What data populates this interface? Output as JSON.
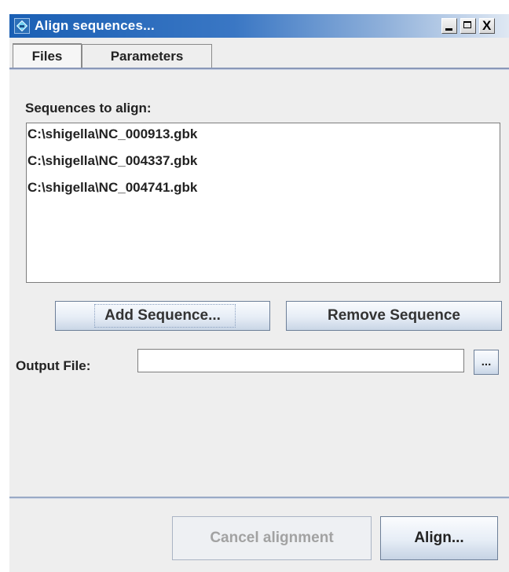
{
  "window": {
    "title": "Align sequences...",
    "minimize_label": "_",
    "maximize_label": "□",
    "close_label": "X"
  },
  "tabs": [
    {
      "label": "Files",
      "active": true
    },
    {
      "label": "Parameters",
      "active": false
    }
  ],
  "files_tab": {
    "sequences_label": "Sequences to align:",
    "sequences": [
      "C:\\shigella\\NC_000913.gbk",
      "C:\\shigella\\NC_004337.gbk",
      "C:\\shigella\\NC_004741.gbk"
    ],
    "add_button": "Add Sequence...",
    "remove_button": "Remove Sequence",
    "output_label": "Output File:",
    "output_value": "",
    "browse_button": "..."
  },
  "footer": {
    "cancel_button": "Cancel alignment",
    "cancel_enabled": false,
    "align_button": "Align..."
  },
  "colors": {
    "titlebar_start": "#1a5fb4",
    "window_bg": "#eeeeee",
    "disabled_text": "#a2a2a2"
  }
}
